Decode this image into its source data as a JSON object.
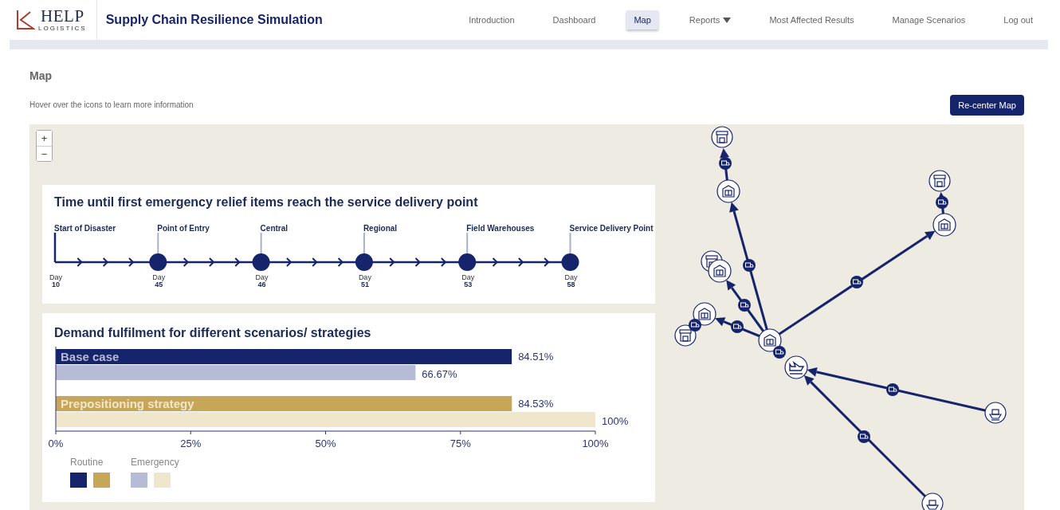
{
  "header": {
    "logo": {
      "main": "HELP",
      "sub": "LOGISTICS"
    },
    "title": "Supply Chain Resilience Simulation",
    "nav": [
      {
        "label": "Introduction",
        "selected": false,
        "kind": "link"
      },
      {
        "label": "Dashboard",
        "selected": false,
        "kind": "link"
      },
      {
        "label": "Map",
        "selected": true,
        "kind": "link"
      },
      {
        "label": "Reports",
        "selected": false,
        "kind": "dropdown"
      },
      {
        "label": "Most Affected Results",
        "selected": false,
        "kind": "link"
      },
      {
        "label": "Manage Scenarios",
        "selected": false,
        "kind": "link"
      },
      {
        "label": "Log out",
        "selected": false,
        "kind": "link"
      }
    ]
  },
  "page": {
    "heading": "Map",
    "hint": "Hover over the icons to learn more information",
    "recenter_button": "Re-center Map"
  },
  "map": {
    "zoom_controls": [
      "+",
      "−"
    ],
    "timeline": {
      "title": "Time until first emergency relief items reach the service delivery point",
      "stops": [
        {
          "kind": "start",
          "label": "Start of Disaster",
          "day_label": "Day",
          "day": "10"
        },
        {
          "kind": "node",
          "label": "Point of Entry",
          "day_label": "Day",
          "day": "45"
        },
        {
          "kind": "node",
          "label": "Central",
          "day_label": "Day",
          "day": "46"
        },
        {
          "kind": "node",
          "label": "Regional",
          "day_label": "Day",
          "day": "51"
        },
        {
          "kind": "node",
          "label": "Field Warehouses",
          "day_label": "Day",
          "day": "53"
        },
        {
          "kind": "node",
          "label": "Service Delivery Point",
          "day_label": "Day",
          "day": "58"
        }
      ]
    },
    "fulfilment": {
      "title": "Demand fulfilment for different scenarios/ strategies",
      "chart_data": {
        "type": "bar",
        "orientation": "horizontal",
        "categories": [
          "Base case",
          "Prepositioning strategy"
        ],
        "series": [
          {
            "color": "#16246b",
            "values": [
              84.51,
              null
            ]
          },
          {
            "color": "#c8a657",
            "values": [
              null,
              84.53
            ]
          },
          {
            "color": "#b6bbd6",
            "values": [
              66.67,
              null
            ]
          },
          {
            "color": "#efe6cc",
            "values": [
              null,
              100
            ]
          }
        ],
        "xlim": [
          0,
          100
        ],
        "xticks": [
          {
            "value": 0,
            "label": "0%"
          },
          {
            "value": 25,
            "label": "25%"
          },
          {
            "value": 50,
            "label": "50%"
          },
          {
            "value": 75,
            "label": "75%"
          },
          {
            "value": 100,
            "label": "100%"
          }
        ],
        "value_labels": [
          [
            "84.51%",
            null
          ],
          [
            null,
            "84.53%"
          ],
          [
            "66.67%",
            null
          ],
          [
            null,
            "100%"
          ]
        ]
      },
      "legend": [
        {
          "label": "Routine"
        },
        {
          "label": "Emergency"
        }
      ]
    }
  }
}
